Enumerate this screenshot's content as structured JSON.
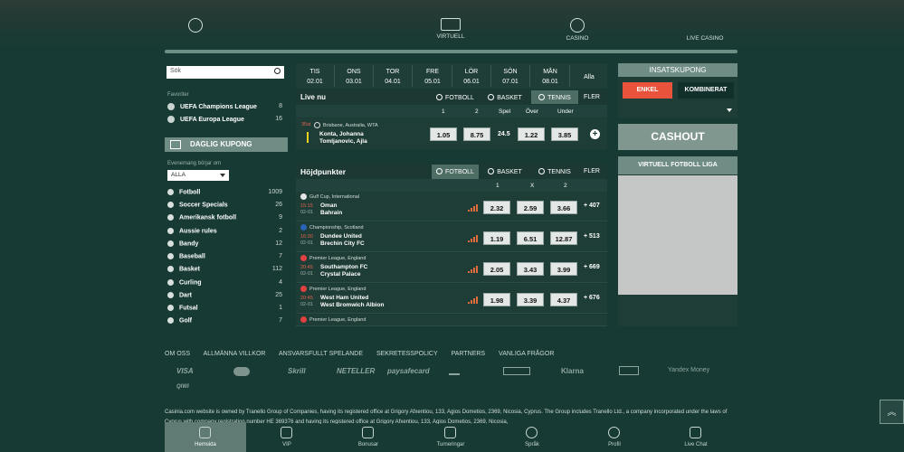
{
  "top_nav": [
    {
      "label": ""
    },
    {
      "label": "VIRTUELL"
    },
    {
      "label": "CASINO"
    },
    {
      "label": "LIVE CASINO"
    }
  ],
  "search": {
    "placeholder": "Sök"
  },
  "favorites": {
    "label": "Favoriter",
    "items": [
      {
        "label": "UEFA Champions League",
        "count": "8"
      },
      {
        "label": "UEFA Europa League",
        "count": "16"
      }
    ]
  },
  "daglig_kupong": "DAGLIG KUPONG",
  "event_filter": {
    "label": "Evenemang börjar om",
    "value": "ALLA"
  },
  "sports": [
    {
      "label": "Fotboll",
      "count": "1009"
    },
    {
      "label": "Soccer Specials",
      "count": "26"
    },
    {
      "label": "Amerikansk fotboll",
      "count": "9"
    },
    {
      "label": "Aussie rules",
      "count": "2"
    },
    {
      "label": "Bandy",
      "count": "12"
    },
    {
      "label": "Baseball",
      "count": "7"
    },
    {
      "label": "Basket",
      "count": "112"
    },
    {
      "label": "Curling",
      "count": "4"
    },
    {
      "label": "Dart",
      "count": "25"
    },
    {
      "label": "Futsal",
      "count": "1"
    },
    {
      "label": "Golf",
      "count": "7"
    }
  ],
  "days": [
    {
      "d": "TIS",
      "date": "02.01"
    },
    {
      "d": "ONS",
      "date": "03.01"
    },
    {
      "d": "TOR",
      "date": "04.01"
    },
    {
      "d": "FRE",
      "date": "05.01"
    },
    {
      "d": "LÖR",
      "date": "06.01"
    },
    {
      "d": "SÖN",
      "date": "07.01"
    },
    {
      "d": "MÅN",
      "date": "08.01"
    },
    {
      "d": "Alla",
      "date": ""
    }
  ],
  "live": {
    "title": "Live nu",
    "tabs": [
      "FOTBOLL",
      "BASKET",
      "TENNIS",
      "FLER"
    ],
    "cols": [
      "1",
      "2",
      "Spel",
      "Över",
      "Under"
    ],
    "match": {
      "time": "35st",
      "league": "Brisbane, Australia, WTA",
      "team1": "Konta, Johanna",
      "team2": "Tomljanovic, Ajla",
      "odd1": "1.05",
      "odd2": "8.75",
      "line": "24.5",
      "over": "1.22",
      "under": "3.85"
    }
  },
  "highlights": {
    "title": "Höjdpunkter",
    "tabs": [
      "FOTBOLL",
      "BASKET",
      "TENNIS",
      "FLER"
    ],
    "cols": [
      "1",
      "X",
      "2"
    ],
    "matches": [
      {
        "league": "Gulf Cup, International",
        "time": "15:15",
        "date": "02-01",
        "team1": "Oman",
        "team2": "Bahrain",
        "o1": "2.32",
        "ox": "2.59",
        "o2": "3.66",
        "more": "+ 407"
      },
      {
        "league": "Championship, Scotland",
        "time": "16:30",
        "date": "02-01",
        "team1": "Dundee United",
        "team2": "Brechin City FC",
        "o1": "1.19",
        "ox": "6.51",
        "o2": "12.87",
        "more": "+ 513"
      },
      {
        "league": "Premier League, England",
        "time": "20:45",
        "date": "02-01",
        "team1": "Southampton FC",
        "team2": "Crystal Palace",
        "o1": "2.05",
        "ox": "3.43",
        "o2": "3.99",
        "more": "+ 669"
      },
      {
        "league": "Premier League, England",
        "time": "20:45",
        "date": "02-01",
        "team1": "West Ham United",
        "team2": "West Bromwich Albion",
        "o1": "1.98",
        "ox": "3.39",
        "o2": "4.37",
        "more": "+ 676"
      },
      {
        "league": "Premier League, England",
        "time": "",
        "date": "",
        "team1": "",
        "team2": "",
        "o1": "",
        "ox": "",
        "o2": "",
        "more": ""
      }
    ]
  },
  "bet_slip": {
    "title": "INSATSKUPONG",
    "single": "ENKEL",
    "combo": "KOMBINERAT"
  },
  "cashout": "CASHOUT",
  "virtual_league": {
    "title": "VIRTUELL FOTBOLL LIGA"
  },
  "footer_links": [
    "OM OSS",
    "ALLMÄNNA VILLKOR",
    "ANSVARSFULLT SPELANDE",
    "SEKRETESSPOLICY",
    "PARTNERS",
    "VANLIGA FRÅGOR"
  ],
  "payment_logos": [
    "VISA",
    "",
    "Skrill",
    "NETELLER",
    "paysafecard",
    "",
    "",
    "Klarna",
    "",
    "Yandex Money",
    "QIWI"
  ],
  "legal": "Casinia.com website is owned by Tranello Group of Companies, having its registered office at Grigory Afxentiou, 133, Agios Dometios, 2369, Nicosia, Cyprus. The Group includes Tranello Ltd., a company incorporated under the laws of Cyprus with company registration number HE 369376 and having its registered office at Grigory Afxentiou, 133, Agios Dometios, 2369, Nicosia,",
  "bottom_nav": [
    "Hemsida",
    "VIP",
    "Bonusar",
    "Turneringar",
    "Språk",
    "Profil",
    "Live Chat"
  ]
}
